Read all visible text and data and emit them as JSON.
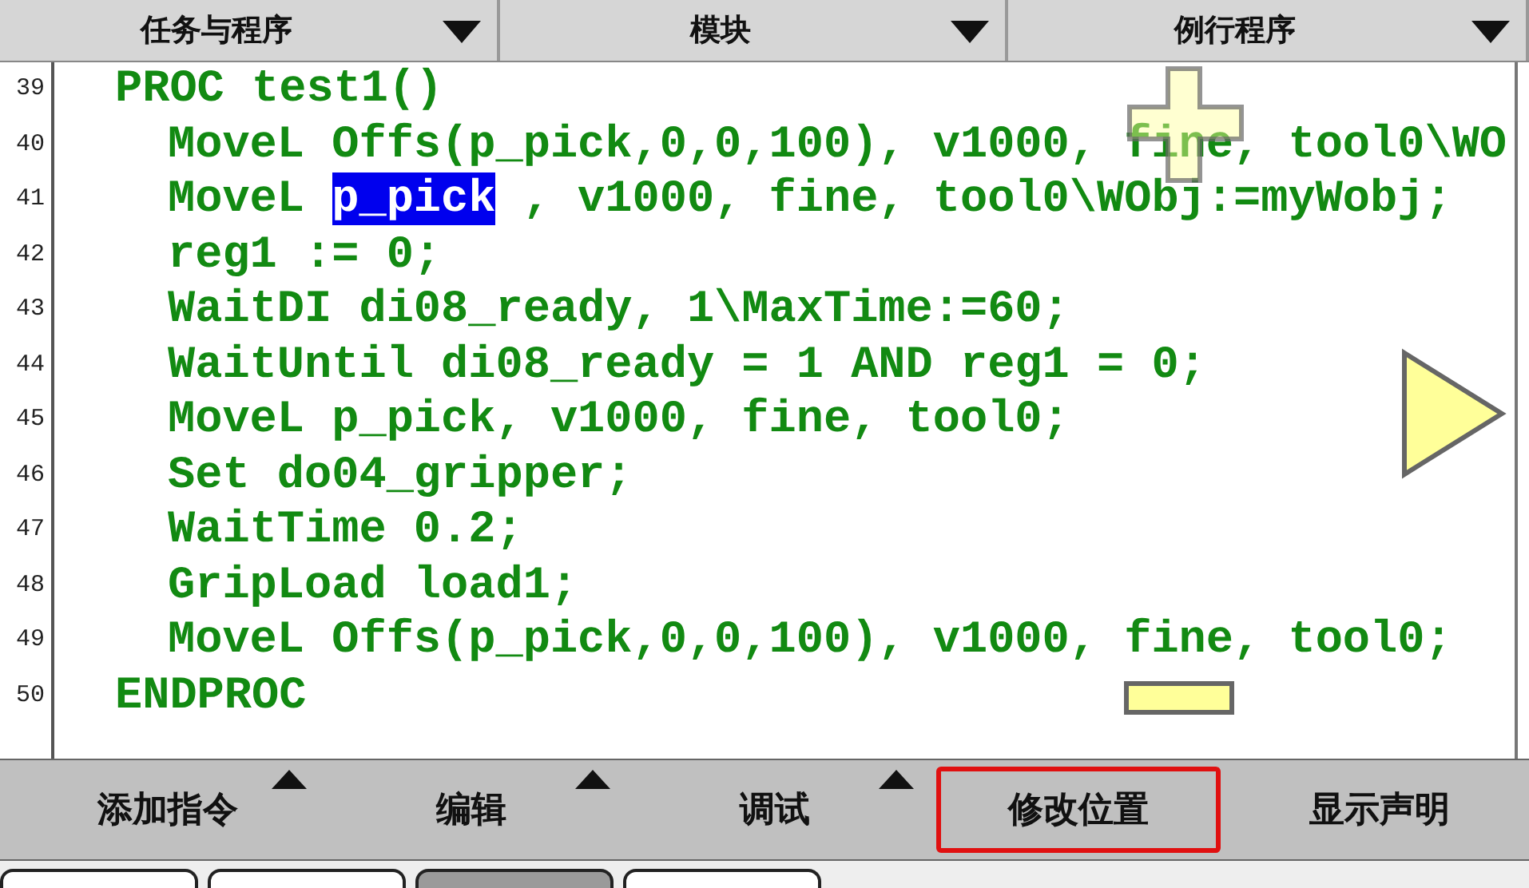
{
  "selectors": [
    {
      "label": "任务与程序"
    },
    {
      "label": "模块"
    },
    {
      "label": "例行程序"
    }
  ],
  "code": [
    {
      "number": "39",
      "text": "PROC test1()",
      "children": [
        {
          "number": "40",
          "text": "MoveL Offs(p_pick,0,0,100), v1000, fine, tool0\\WO"
        },
        {
          "number": "41",
          "segments": [
            {
              "text": "MoveL ",
              "selected": false
            },
            {
              "text": "p_pick",
              "selected": true
            },
            {
              "text": " , v1000, fine, tool0\\WObj:=myWobj;",
              "selected": false
            }
          ]
        },
        {
          "number": "42",
          "text": "reg1 := 0;"
        },
        {
          "number": "43",
          "text": "WaitDI di08_ready, 1\\MaxTime:=60;"
        },
        {
          "number": "44",
          "text": "WaitUntil di08_ready = 1 AND reg1 = 0;"
        },
        {
          "number": "45",
          "text": "MoveL p_pick, v1000, fine, tool0;"
        },
        {
          "number": "46",
          "text": "Set do04_gripper;"
        },
        {
          "number": "47",
          "text": "WaitTime 0.2;"
        },
        {
          "number": "48",
          "text": "GripLoad load1;"
        },
        {
          "number": "49",
          "text": "MoveL Offs(p_pick,0,0,100), v1000, fine, tool0;"
        }
      ]
    },
    {
      "number": "50",
      "text": "ENDPROC"
    }
  ],
  "menu": [
    {
      "label": "添加指令",
      "has_submenu": true,
      "annotated": false
    },
    {
      "label": "编辑",
      "has_submenu": true,
      "annotated": false
    },
    {
      "label": "调试",
      "has_submenu": true,
      "annotated": false
    },
    {
      "label": "修改位置",
      "has_submenu": false,
      "annotated": true
    },
    {
      "label": "显示声明",
      "has_submenu": false,
      "annotated": false
    }
  ],
  "bottom_tabs": [
    {
      "selected": false
    },
    {
      "selected": false
    },
    {
      "selected": true
    },
    {
      "selected": false
    }
  ]
}
